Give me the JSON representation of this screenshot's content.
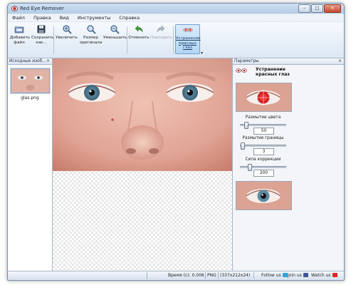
{
  "window": {
    "title": "Red Eye Remover",
    "controls": {
      "minimize": "–",
      "maximize": "□",
      "close": "✕"
    }
  },
  "menu": [
    "Файл",
    "Правка",
    "Вид",
    "Инструменты",
    "Справка"
  ],
  "toolbar": {
    "add_file": {
      "line1": "Добавить",
      "line2": "файл",
      "icon": "folder-add-icon"
    },
    "save_as": {
      "line1": "Сохранить",
      "line2": "как...",
      "icon": "floppy-disk-icon"
    },
    "zoom_in": {
      "line1": "Увеличить",
      "icon": "zoom-in-icon"
    },
    "original_size": {
      "line1": "Размер",
      "line2": "оригинала",
      "icon": "zoom-original-icon"
    },
    "zoom_out": {
      "line1": "Уменьшить",
      "icon": "zoom-out-icon"
    },
    "undo": {
      "line1": "Отменить",
      "icon": "undo-arrow-icon"
    },
    "redo": {
      "line1": "Повторить",
      "icon": "redo-arrow-icon"
    },
    "red_eye": {
      "line1": "Устранение",
      "line2": "красных",
      "line3": "глаз",
      "icon": "red-eye-icon"
    },
    "overflow": "▾"
  },
  "left_panel": {
    "header": "Исходные изоб...",
    "close": "×",
    "files": [
      {
        "name": "glas.png"
      }
    ]
  },
  "right_panel": {
    "header": "Параметры",
    "close": "×",
    "tool_title_line1": "Устранение",
    "tool_title_line2": "красных глаз",
    "sliders": [
      {
        "label": "Размытие цвета",
        "value": "50",
        "level": 0.12
      },
      {
        "label": "Размытие границы",
        "value": "3",
        "level": 0.05
      },
      {
        "label": "Сила коррекции",
        "value": "200",
        "level": 0.2
      }
    ]
  },
  "status": {
    "time": "Время (с): 0.006",
    "format": "PNG",
    "dimensions": "(337x212x24)",
    "follow_us": "Follow us",
    "join_us": "Join us",
    "watch_us": "Watch us"
  },
  "colors": {
    "accent": "#3a78c2",
    "twitter": "#2fa6e0",
    "facebook": "#3b5998",
    "youtube": "#d32c1e"
  }
}
